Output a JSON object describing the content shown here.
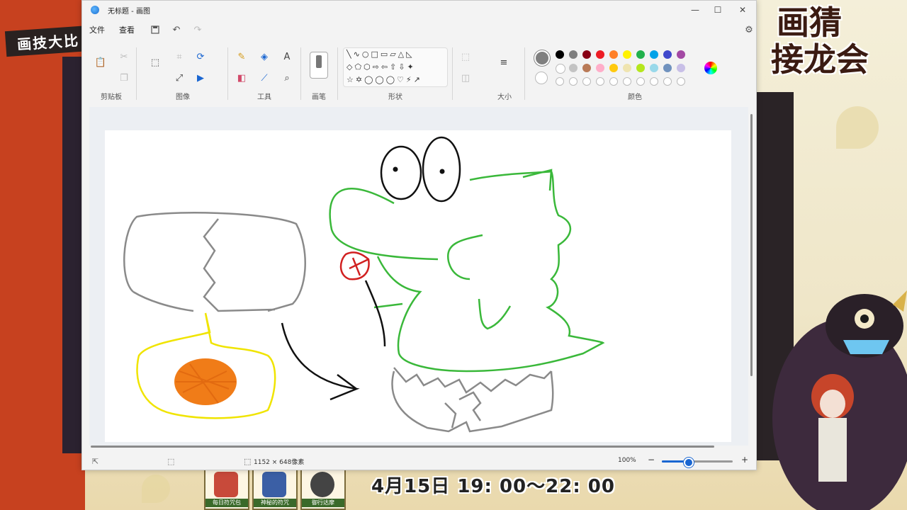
{
  "stream": {
    "left_banner": "画技大比",
    "right_title_line1": "画猜",
    "right_title_line2": "接龙会",
    "date_text": "4月15日  19: 00～22: 00",
    "stickers": [
      {
        "caption": "每日符咒包",
        "color": "#c84a3a"
      },
      {
        "caption": "神秘的符咒",
        "color": "#3b5fa5"
      },
      {
        "caption": "御行达摩",
        "color": "#444444"
      }
    ]
  },
  "window": {
    "title": "无标题 - 画图",
    "minimize": "—",
    "maximize": "☐",
    "close": "✕"
  },
  "menu": {
    "file": "文件",
    "view": "查看",
    "save_icon": "save-icon",
    "undo_icon": "undo-icon",
    "redo_icon": "redo-icon",
    "settings_icon": "settings-icon"
  },
  "ribbon": {
    "clipboard": "剪贴板",
    "image": "图像",
    "tools": "工具",
    "brushes": "画笔",
    "shapes": "形状",
    "size": "大小",
    "colors": "颜色"
  },
  "palette": {
    "row1": [
      "#000000",
      "#7f7f7f",
      "#880015",
      "#ed1c24",
      "#ff7f27",
      "#fff200",
      "#22b14c",
      "#00a2e8",
      "#3f48cc",
      "#a349a4"
    ],
    "row2": [
      "#ffffff",
      "#c3c3c3",
      "#b97a57",
      "#ffaec9",
      "#ffc90e",
      "#efe4b0",
      "#b5e61d",
      "#99d9ea",
      "#7092be",
      "#c8bfe7"
    ],
    "primary": "#7f7f7f",
    "secondary": "#ffffff"
  },
  "status": {
    "canvas_size": "1152 × 648像素",
    "zoom": "100%",
    "zoom_fraction": 0.38
  }
}
